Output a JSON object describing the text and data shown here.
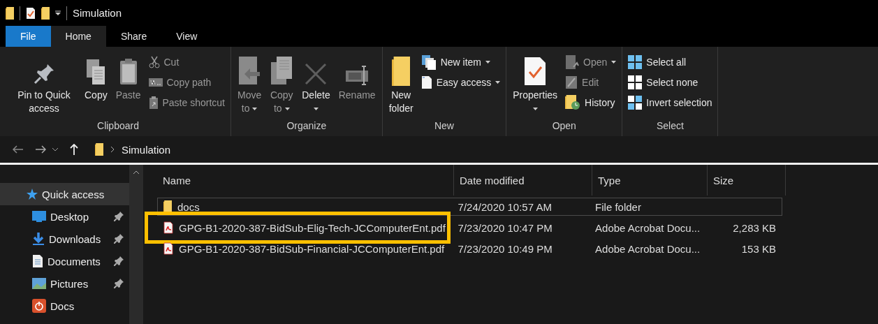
{
  "title_bar": {
    "title": "Simulation"
  },
  "tabs": [
    {
      "label": "File",
      "kind": "file",
      "selected": false
    },
    {
      "label": "Home",
      "kind": "tab",
      "selected": true
    },
    {
      "label": "Share",
      "kind": "tab",
      "selected": false
    },
    {
      "label": "View",
      "kind": "tab",
      "selected": false
    }
  ],
  "ribbon": {
    "groups": [
      {
        "label": "Clipboard",
        "columns": [
          {
            "kind": "large",
            "label": "Pin to Quick access",
            "caret": false,
            "disabled": false
          },
          {
            "kind": "large",
            "label": "Copy",
            "caret": false,
            "disabled": false
          },
          {
            "kind": "large",
            "label": "Paste",
            "caret": false,
            "disabled": true
          },
          {
            "kind": "stack",
            "items": [
              {
                "label": "Cut",
                "caret": false,
                "disabled": true
              },
              {
                "label": "Copy path",
                "caret": false,
                "disabled": true
              },
              {
                "label": "Paste shortcut",
                "caret": false,
                "disabled": true
              }
            ]
          }
        ]
      },
      {
        "label": "Organize",
        "columns": [
          {
            "kind": "large",
            "label": "Move to",
            "caret": true,
            "disabled": true
          },
          {
            "kind": "large",
            "label": "Copy to",
            "caret": true,
            "disabled": true
          },
          {
            "kind": "large",
            "label": "Delete",
            "caret": true,
            "disabled": false
          },
          {
            "kind": "large",
            "label": "Rename",
            "caret": false,
            "disabled": true
          }
        ]
      },
      {
        "label": "New",
        "columns": [
          {
            "kind": "large",
            "label": "New folder",
            "caret": false,
            "disabled": false
          },
          {
            "kind": "stack",
            "items": [
              {
                "label": "New item",
                "caret": true,
                "disabled": false
              },
              {
                "label": "Easy access",
                "caret": true,
                "disabled": false
              }
            ]
          }
        ]
      },
      {
        "label": "Open",
        "columns": [
          {
            "kind": "large",
            "label": "Properties",
            "caret": true,
            "disabled": false
          },
          {
            "kind": "stack",
            "items": [
              {
                "label": "Open",
                "caret": true,
                "disabled": true
              },
              {
                "label": "Edit",
                "caret": false,
                "disabled": true
              },
              {
                "label": "History",
                "caret": false,
                "disabled": false
              }
            ]
          }
        ]
      },
      {
        "label": "Select",
        "columns": [
          {
            "kind": "stack",
            "items": [
              {
                "label": "Select all",
                "caret": false,
                "disabled": false
              },
              {
                "label": "Select none",
                "caret": false,
                "disabled": false
              },
              {
                "label": "Invert selection",
                "caret": false,
                "disabled": false
              }
            ]
          }
        ]
      }
    ]
  },
  "address_bar": {
    "path": [
      "Simulation"
    ]
  },
  "sidebar": {
    "items": [
      {
        "label": "Quick access",
        "selected": true,
        "children": [
          {
            "label": "Desktop",
            "kind": "desktop",
            "pinned": true,
            "selected": false
          },
          {
            "label": "Downloads",
            "kind": "downloads",
            "pinned": true,
            "selected": false
          },
          {
            "label": "Documents",
            "kind": "documents",
            "pinned": true,
            "selected": false
          },
          {
            "label": "Pictures",
            "kind": "pictures",
            "pinned": true,
            "selected": false
          },
          {
            "label": "Docs",
            "kind": "app",
            "pinned": false,
            "selected": false
          }
        ]
      }
    ]
  },
  "file_list": {
    "columns": [
      "Name",
      "Date modified",
      "Type",
      "Size"
    ],
    "rows": [
      {
        "kind": "folder",
        "name": "docs",
        "date": "7/24/2020 10:57 AM",
        "type": "File folder",
        "size": null,
        "focused": true,
        "highlighted": false
      },
      {
        "kind": "pdf",
        "name": "GPG-B1-2020-387-BidSub-Elig-Tech-JCComputerEnt.pdf",
        "date": "7/23/2020 10:47 PM",
        "type": "Adobe Acrobat Docu...",
        "size": "2,283 KB",
        "focused": false,
        "highlighted": true
      },
      {
        "kind": "pdf",
        "name": "GPG-B1-2020-387-BidSub-Financial-JCComputerEnt.pdf",
        "date": "7/23/2020 10:49 PM",
        "type": "Adobe Acrobat Docu...",
        "size": "153 KB",
        "focused": false,
        "highlighted": false
      }
    ]
  }
}
